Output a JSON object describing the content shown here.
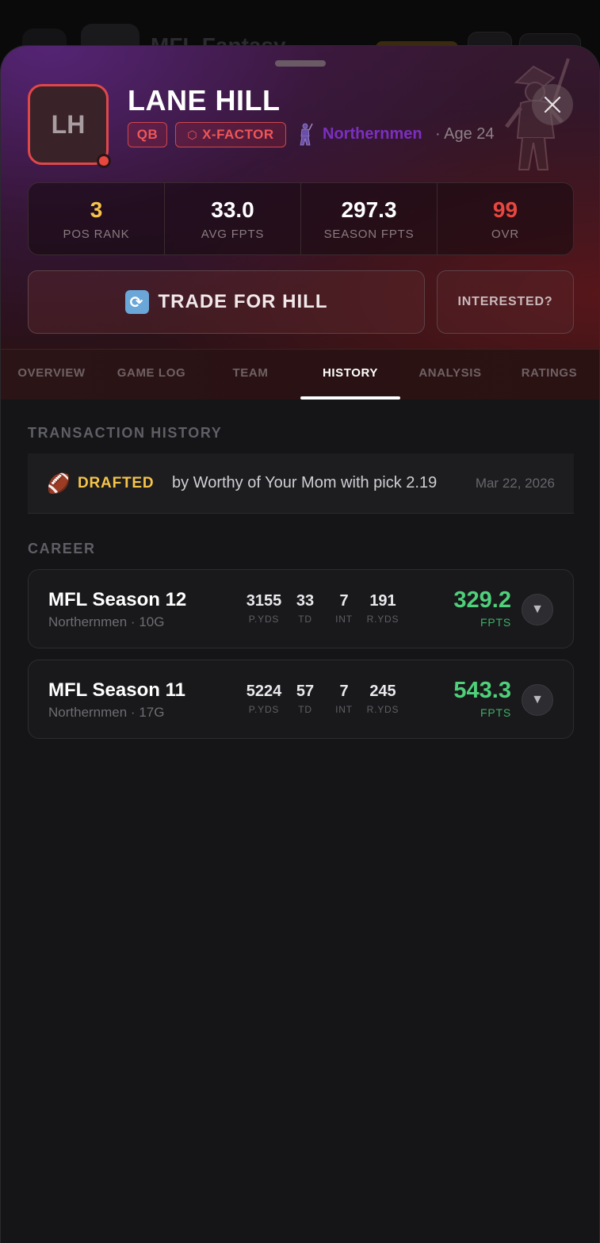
{
  "background": {
    "title": "MFL Fantasy"
  },
  "player": {
    "initials": "LH",
    "name": "LANE HILL",
    "position": "QB",
    "badge_icon": "hexagon-icon",
    "badge": "X-FACTOR",
    "team": "Northernmen",
    "age_text": "· Age 24"
  },
  "stats": [
    {
      "value": "3",
      "label": "POS RANK"
    },
    {
      "value": "33.0",
      "label": "AVG FPTS"
    },
    {
      "value": "297.3",
      "label": "SEASON FPTS"
    },
    {
      "value": "99",
      "label": "OVR"
    }
  ],
  "actions": {
    "trade_label": "TRADE FOR HILL",
    "trade_icon": "swap-icon",
    "interested_label": "INTERESTED?"
  },
  "tabs": [
    {
      "label": "OVERVIEW"
    },
    {
      "label": "GAME LOG"
    },
    {
      "label": "TEAM"
    },
    {
      "label": "HISTORY",
      "active": true
    },
    {
      "label": "ANALYSIS"
    },
    {
      "label": "RATINGS"
    }
  ],
  "transactions": {
    "title": "TRANSACTION HISTORY",
    "items": [
      {
        "icon": "football-icon",
        "type": "DRAFTED",
        "description": "by Worthy of Your Mom with pick 2.19",
        "date": "Mar 22, 2026"
      }
    ]
  },
  "career": {
    "title": "CAREER",
    "seasons": [
      {
        "name": "MFL Season 12",
        "sub": "Northernmen · 10G",
        "stats": [
          {
            "v": "3155",
            "l": "P.YDS"
          },
          {
            "v": "33",
            "l": "TD"
          },
          {
            "v": "7",
            "l": "INT"
          },
          {
            "v": "191",
            "l": "R.YDS"
          }
        ],
        "fpts": "329.2",
        "fpts_label": "FPTS"
      },
      {
        "name": "MFL Season 11",
        "sub": "Northernmen · 17G",
        "stats": [
          {
            "v": "5224",
            "l": "P.YDS"
          },
          {
            "v": "57",
            "l": "TD"
          },
          {
            "v": "7",
            "l": "INT"
          },
          {
            "v": "245",
            "l": "R.YDS"
          }
        ],
        "fpts": "543.3",
        "fpts_label": "FPTS"
      }
    ]
  },
  "colors": {
    "accent_red": "#e8473f",
    "gold": "#f6c449",
    "team_purple": "#7b2fc0",
    "fpts_green": "#4fd07a"
  }
}
